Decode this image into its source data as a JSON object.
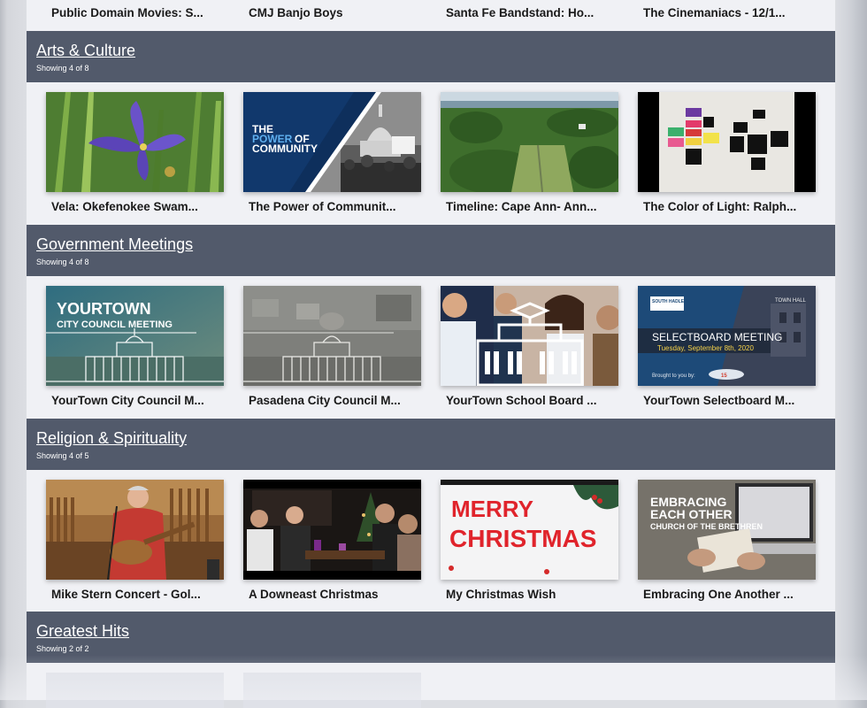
{
  "top_row": {
    "titles": [
      "Public Domain Movies: S...",
      "CMJ Banjo Boys",
      "Santa Fe Bandstand: Ho...",
      "The Cinemaniacs - 12/1..."
    ]
  },
  "sections": [
    {
      "heading": "Arts & Culture",
      "showing": "Showing 4 of 8",
      "items": [
        {
          "title": "Vela: Okefenokee Swam...",
          "thumb_icon": "iris-flower-thumbnail"
        },
        {
          "title": "The Power of Communit...",
          "thumb_icon": "capitol-protest-thumbnail",
          "thumb_text": [
            "THE",
            "POWER",
            "OF",
            "COMMUNITY"
          ]
        },
        {
          "title": "Timeline: Cape Ann- Ann...",
          "thumb_icon": "aerial-cemetery-thumbnail"
        },
        {
          "title": "The Color of Light: Ralph...",
          "thumb_icon": "color-squares-thumbnail"
        }
      ]
    },
    {
      "heading": "Government Meetings",
      "showing": "Showing 4 of 8",
      "items": [
        {
          "title": "YourTown City Council M...",
          "thumb_icon": "city-hall-thumbnail",
          "thumb_text": [
            "YOURTOWN",
            "CITY COUNCIL MEETING"
          ]
        },
        {
          "title": "Pasadena City Council M...",
          "thumb_icon": "city-hall-aerial-thumbnail"
        },
        {
          "title": "YourTown School Board ...",
          "thumb_icon": "school-board-thumbnail"
        },
        {
          "title": "YourTown Selectboard M...",
          "thumb_icon": "selectboard-thumbnail",
          "thumb_text": [
            "SOUTH HADLEY",
            "SELECTBOARD MEETING",
            "Tuesday, September 8th, 2020",
            "Brought to you by:",
            "TOWN HALL"
          ]
        }
      ]
    },
    {
      "heading": "Religion & Spirituality",
      "showing": "Showing 4 of 5",
      "items": [
        {
          "title": "Mike Stern Concert - Gol...",
          "thumb_icon": "guitar-singer-thumbnail"
        },
        {
          "title": "A Downeast Christmas",
          "thumb_icon": "people-at-table-thumbnail"
        },
        {
          "title": "My Christmas Wish",
          "thumb_icon": "merry-christmas-thumbnail",
          "thumb_text": [
            "MERRY",
            "CHRISTMAS"
          ]
        },
        {
          "title": "Embracing One Another ...",
          "thumb_icon": "embracing-laptop-thumbnail",
          "thumb_text": [
            "EMBRACING",
            "EACH OTHER",
            "CHURCH OF THE BRETHREN"
          ]
        }
      ]
    },
    {
      "heading": "Greatest Hits",
      "showing": "Showing 2 of 2",
      "items": []
    }
  ],
  "colors": {
    "band": "#525a6b",
    "page": "#f0f1f5",
    "navy_thumb": "#1d4a78",
    "christmas_red": "#e0242c"
  }
}
